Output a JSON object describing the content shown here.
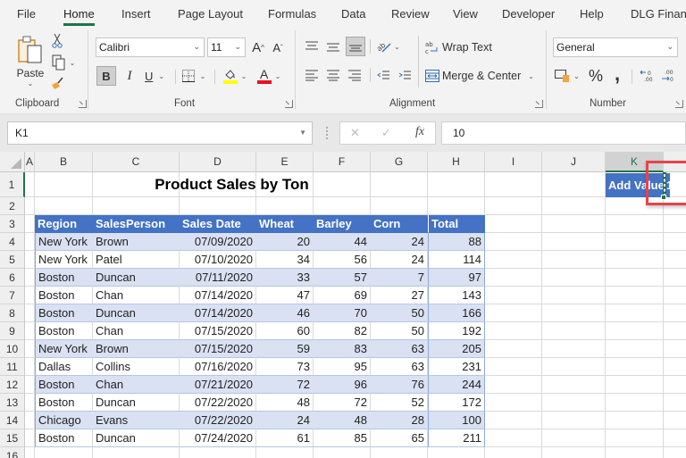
{
  "ribbon": {
    "tabs": [
      "File",
      "Home",
      "Insert",
      "Page Layout",
      "Formulas",
      "Data",
      "Review",
      "View",
      "Developer",
      "Help",
      "DLG Financ"
    ],
    "active_tab": "Home",
    "clipboard": {
      "paste_label": "Paste",
      "group_label": "Clipboard"
    },
    "font": {
      "font_name": "Calibri",
      "font_size": "11",
      "group_label": "Font",
      "bold": "B",
      "italic": "I",
      "underline": "U",
      "font_color_glyph": "A",
      "grow_glyph": "A",
      "shrink_glyph": "A"
    },
    "alignment": {
      "wrap_text": "Wrap Text",
      "merge_center": "Merge & Center",
      "group_label": "Alignment"
    },
    "number": {
      "format": "General",
      "percent": "%",
      "comma": ",",
      "group_label": "Number"
    }
  },
  "formula_bar": {
    "name_box": "K1",
    "cancel_glyph": "✕",
    "enter_glyph": "✓",
    "fx_glyph": "fx",
    "formula": "10"
  },
  "grid": {
    "columns": [
      "A",
      "B",
      "C",
      "D",
      "E",
      "F",
      "G",
      "H",
      "I",
      "J",
      "K"
    ],
    "selected_column": "K",
    "rows": [
      "1",
      "2",
      "3",
      "4",
      "5",
      "6",
      "7",
      "8",
      "9",
      "10",
      "11",
      "12",
      "13",
      "14",
      "15",
      "16"
    ],
    "title": "Product Sales by Ton",
    "add_value_label": "Add Value",
    "add_value": "10",
    "table": {
      "headers": [
        "Region",
        "SalesPerson",
        "Sales Date",
        "Wheat",
        "Barley",
        "Corn",
        "Total"
      ],
      "rows": [
        [
          "New York",
          "Brown",
          "07/09/2020",
          "20",
          "44",
          "24",
          "88"
        ],
        [
          "New York",
          "Patel",
          "07/10/2020",
          "34",
          "56",
          "24",
          "114"
        ],
        [
          "Boston",
          "Duncan",
          "07/11/2020",
          "33",
          "57",
          "7",
          "97"
        ],
        [
          "Boston",
          "Chan",
          "07/14/2020",
          "47",
          "69",
          "27",
          "143"
        ],
        [
          "Boston",
          "Duncan",
          "07/14/2020",
          "46",
          "70",
          "50",
          "166"
        ],
        [
          "Boston",
          "Chan",
          "07/15/2020",
          "60",
          "82",
          "50",
          "192"
        ],
        [
          "New York",
          "Brown",
          "07/15/2020",
          "59",
          "83",
          "63",
          "205"
        ],
        [
          "Dallas",
          "Collins",
          "07/16/2020",
          "73",
          "95",
          "63",
          "231"
        ],
        [
          "Boston",
          "Chan",
          "07/21/2020",
          "72",
          "96",
          "76",
          "244"
        ],
        [
          "Boston",
          "Duncan",
          "07/22/2020",
          "48",
          "72",
          "52",
          "172"
        ],
        [
          "Chicago",
          "Evans",
          "07/22/2020",
          "24",
          "48",
          "28",
          "100"
        ],
        [
          "Boston",
          "Duncan",
          "07/24/2020",
          "61",
          "85",
          "65",
          "211"
        ]
      ]
    }
  },
  "colors": {
    "excel_green": "#217346",
    "table_header": "#4472c4",
    "table_band": "#d9e1f2",
    "highlight_box": "#e8434a"
  }
}
